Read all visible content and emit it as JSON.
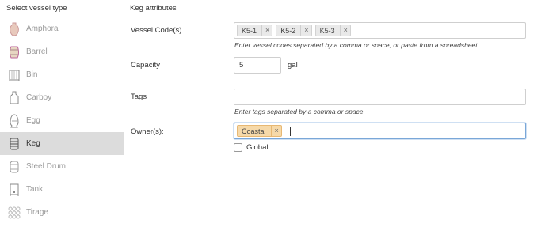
{
  "sidebar": {
    "title": "Select vessel type",
    "items": [
      {
        "label": "Amphora",
        "icon": "amphora-icon",
        "active": false
      },
      {
        "label": "Barrel",
        "icon": "barrel-icon",
        "active": false
      },
      {
        "label": "Bin",
        "icon": "bin-icon",
        "active": false
      },
      {
        "label": "Carboy",
        "icon": "carboy-icon",
        "active": false
      },
      {
        "label": "Egg",
        "icon": "egg-icon",
        "active": false
      },
      {
        "label": "Keg",
        "icon": "keg-icon",
        "active": true
      },
      {
        "label": "Steel Drum",
        "icon": "steel-drum-icon",
        "active": false
      },
      {
        "label": "Tank",
        "icon": "tank-icon",
        "active": false
      },
      {
        "label": "Tirage",
        "icon": "tirage-icon",
        "active": false
      }
    ]
  },
  "main": {
    "title": "Keg attributes",
    "vessel_codes": {
      "label": "Vessel Code(s)",
      "chips": [
        "K5-1",
        "K5-2",
        "K5-3"
      ],
      "remove_glyph": "×",
      "hint": "Enter vessel codes separated by a comma or space, or paste from a spreadsheet"
    },
    "capacity": {
      "label": "Capacity",
      "value": "5",
      "unit": "gal"
    },
    "tags": {
      "label": "Tags",
      "value": "",
      "hint": "Enter tags separated by a comma or space"
    },
    "owners": {
      "label": "Owner(s):",
      "chips": [
        "Coastal"
      ],
      "remove_glyph": "×",
      "chip_color": "#f6d9a9"
    },
    "global": {
      "label": "Global",
      "checked": false
    }
  }
}
